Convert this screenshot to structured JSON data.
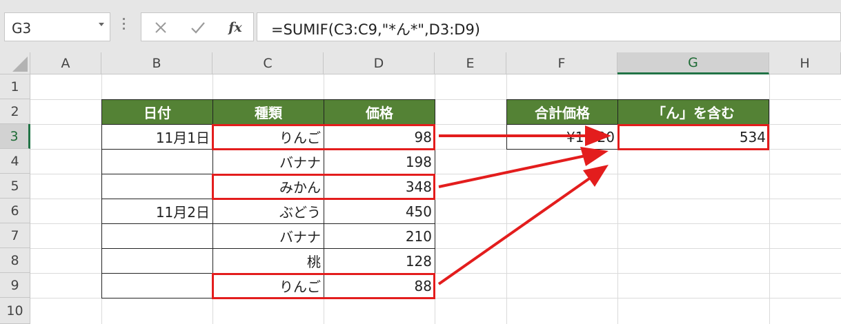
{
  "name_box": {
    "value": "G3"
  },
  "formula_bar": {
    "cancel_glyph": "✕",
    "enter_glyph": "✔",
    "fx_label": "fx",
    "formula": "=SUMIF(C3:C9,\"*ん*\",D3:D9)"
  },
  "columns": [
    "A",
    "B",
    "C",
    "D",
    "E",
    "F",
    "G",
    "H"
  ],
  "rows": [
    "1",
    "2",
    "3",
    "4",
    "5",
    "6",
    "7",
    "8",
    "9",
    "10"
  ],
  "table": {
    "headers": [
      "日付",
      "種類",
      "価格"
    ],
    "rows": [
      {
        "date": "11月1日",
        "type": "りんご",
        "price": "98"
      },
      {
        "date": "",
        "type": "バナナ",
        "price": "198"
      },
      {
        "date": "",
        "type": "みかん",
        "price": "348"
      },
      {
        "date": "11月2日",
        "type": "ぶどう",
        "price": "450"
      },
      {
        "date": "",
        "type": "バナナ",
        "price": "210"
      },
      {
        "date": "",
        "type": "桃",
        "price": "128"
      },
      {
        "date": "",
        "type": "りんご",
        "price": "88"
      }
    ]
  },
  "summary": {
    "total_header": "合計価格",
    "contains_header": "「ん」を含む",
    "total_value": "¥1,520",
    "contains_value": "534"
  },
  "colors": {
    "header_fill": "#548235",
    "highlight": "#e31d1d",
    "selection": "#217346"
  }
}
